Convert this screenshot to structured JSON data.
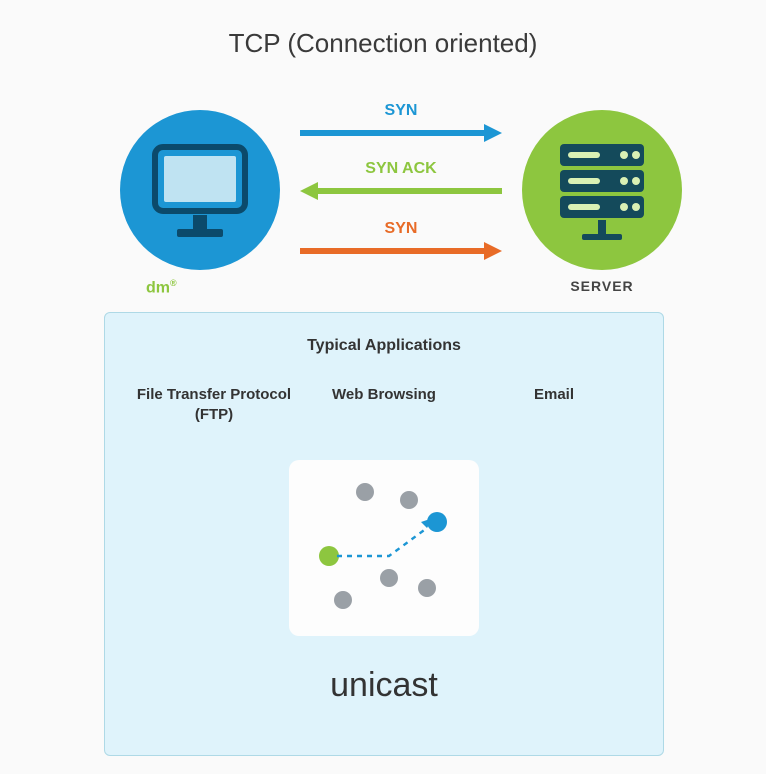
{
  "title": "TCP (Connection oriented)",
  "client": {
    "label": "dm",
    "label_sup": "®"
  },
  "server": {
    "label": "SERVER"
  },
  "handshake": {
    "a1": {
      "label": "SYN",
      "color": "#1c96d4",
      "dir": "right"
    },
    "a2": {
      "label": "SYN ACK",
      "color": "#8dc63f",
      "dir": "left"
    },
    "a3": {
      "label": "SYN",
      "color": "#e86b27",
      "dir": "right"
    }
  },
  "panel": {
    "heading": "Typical Applications",
    "apps": {
      "a": "File Transfer Protocol (FTP)",
      "b": "Web Browsing",
      "c": "Email"
    },
    "mode": "unicast"
  }
}
